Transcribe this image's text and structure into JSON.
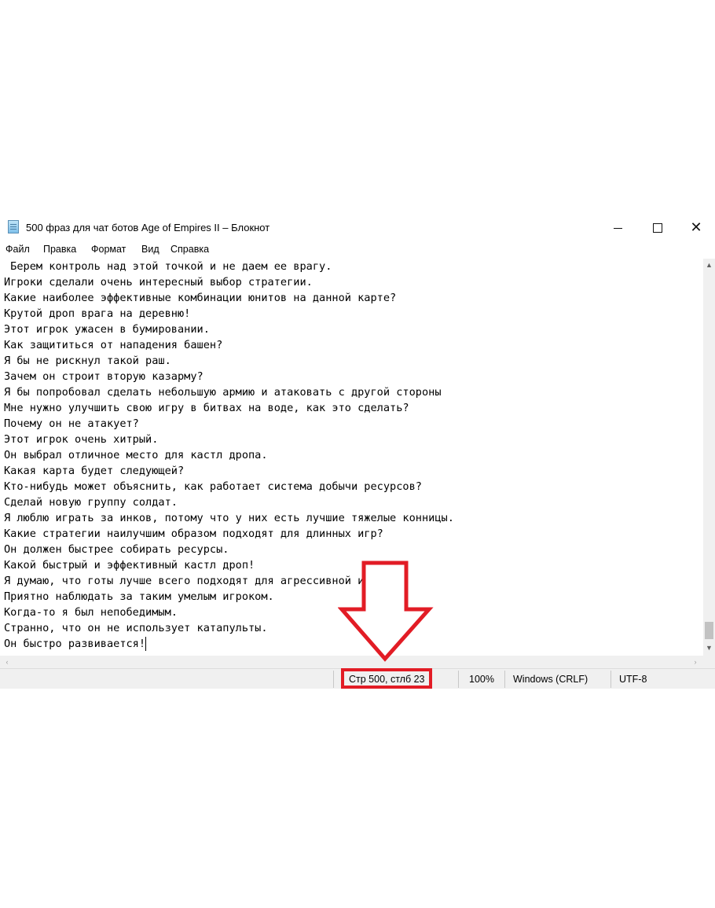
{
  "window": {
    "title": "500 фраз для чат ботов Age of Empires II – Блокнот",
    "minimize_glyph": "",
    "close_glyph": "✕"
  },
  "menu": {
    "items": [
      "Файл",
      "Правка",
      "Формат",
      "Вид",
      "Справка"
    ]
  },
  "editor": {
    "lines": [
      " Берем контроль над этой точкой и не даем ее врагу.",
      "Игроки сделали очень интересный выбор стратегии.",
      "Какие наиболее эффективные комбинации юнитов на данной карте?",
      "Крутой дроп врага на деревню!",
      "Этот игрок ужасен в бумировании.",
      "Как защититься от нападения башен?",
      "Я бы не рискнул такой раш.",
      "Зачем он строит вторую казарму?",
      "Я бы попробовал сделать небольшую армию и атаковать с другой стороны",
      "Мне нужно улучшить свою игру в битвах на воде, как это сделать?",
      "Почему он не атакует?",
      "Этот игрок очень хитрый.",
      "Он выбрал отличное место для кастл дропа.",
      "Какая карта будет следующей?",
      "Кто-нибудь может объяснить, как работает система добычи ресурсов?",
      "Сделай новую группу солдат.",
      "Я люблю играть за инков, потому что у них есть лучшие тяжелые конницы.",
      "Какие стратегии наилучшим образом подходят для длинных игр?",
      "Он должен быстрее собирать ресурсы.",
      "Какой быстрый и эффективный кастл дроп!",
      "Я думаю, что готы лучше всего подходят для агрессивной игры.",
      "Приятно наблюдать за таким умелым игроком.",
      "Когда-то я был непобедимым.",
      "Странно, что он не использует катапульты.",
      "Он быстро развивается!"
    ]
  },
  "scrollbars": {
    "up_arrow": "▲",
    "down_arrow": "▼",
    "left_arrow": "‹",
    "right_arrow": "›"
  },
  "statusbar": {
    "position": "Стр 500, стлб 23",
    "zoom": "100%",
    "line_ending": "Windows (CRLF)",
    "encoding": "UTF-8"
  },
  "annotation": {
    "color": "#e21c25",
    "arrow_icon": "down-arrow-outline-icon"
  }
}
